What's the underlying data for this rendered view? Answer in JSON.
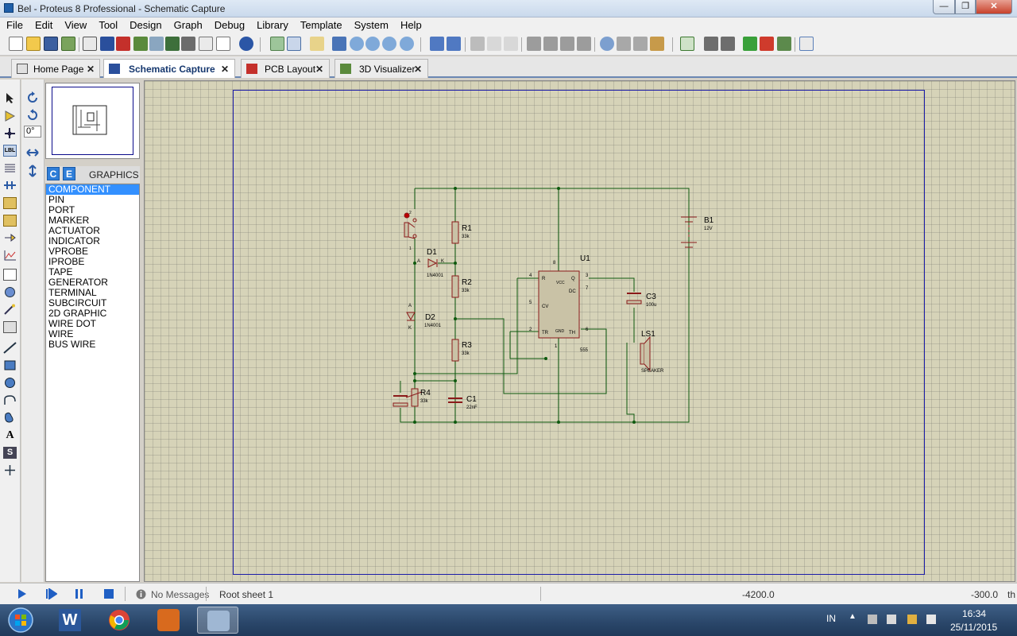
{
  "window": {
    "title": "Bel - Proteus 8 Professional - Schematic Capture",
    "min": "—",
    "max": "❐",
    "close": "✕"
  },
  "menu": [
    "File",
    "Edit",
    "View",
    "Tool",
    "Design",
    "Graph",
    "Debug",
    "Library",
    "Template",
    "System",
    "Help"
  ],
  "tabs": [
    {
      "label": "Home Page",
      "close": "✕"
    },
    {
      "label": "Schematic Capture",
      "close": "✕"
    },
    {
      "label": "PCB Layout",
      "close": "✕"
    },
    {
      "label": "3D Visualizer",
      "close": "✕"
    }
  ],
  "rotation": "0°",
  "object_selector": {
    "btn_c": "C",
    "btn_e": "E",
    "title": "GRAPHICS",
    "items": [
      "COMPONENT",
      "PIN",
      "PORT",
      "MARKER",
      "ACTUATOR",
      "INDICATOR",
      "VPROBE",
      "IPROBE",
      "TAPE",
      "GENERATOR",
      "TERMINAL",
      "SUBCIRCUIT",
      "2D GRAPHIC",
      "WIRE DOT",
      "WIRE",
      "BUS WIRE"
    ],
    "selected": "COMPONENT"
  },
  "schematic": {
    "r1": {
      "ref": "R1",
      "val": "33k"
    },
    "r2": {
      "ref": "R2",
      "val": "33k"
    },
    "r3": {
      "ref": "R3",
      "val": "33k"
    },
    "r4": {
      "ref": "R4",
      "val": "33k"
    },
    "d1": {
      "ref": "D1",
      "val": "1N4001",
      "a": "A",
      "k": "K"
    },
    "d2": {
      "ref": "D2",
      "val": "1N4001",
      "a": "A",
      "k": "K"
    },
    "c1": {
      "ref": "C1",
      "val": "22nF"
    },
    "c3": {
      "ref": "C3",
      "val": "100u"
    },
    "b1": {
      "ref": "B1",
      "val": "12V"
    },
    "ls1": {
      "ref": "LS1",
      "val": "SPEAKER"
    },
    "u1": {
      "ref": "U1",
      "val": "555",
      "pins": {
        "r": "R",
        "vcc": "VCC",
        "q": "Q",
        "dc": "DC",
        "cv": "CV",
        "tr": "TR",
        "gnd": "GND",
        "th": "TH"
      },
      "nums": {
        "p4": "4",
        "p8": "8",
        "p3": "3",
        "p7": "7",
        "p5": "5",
        "p2": "2",
        "p1": "1",
        "p6": "6"
      }
    },
    "sw": {
      "p1": "1",
      "p2": "2"
    }
  },
  "status": {
    "messages": "No Messages",
    "sheet": "Root sheet 1",
    "x": "-4200.0",
    "y": "-300.0",
    "unit": "th"
  },
  "taskbar": {
    "lang": "IN",
    "time": "16:34",
    "date": "25/11/2015"
  }
}
